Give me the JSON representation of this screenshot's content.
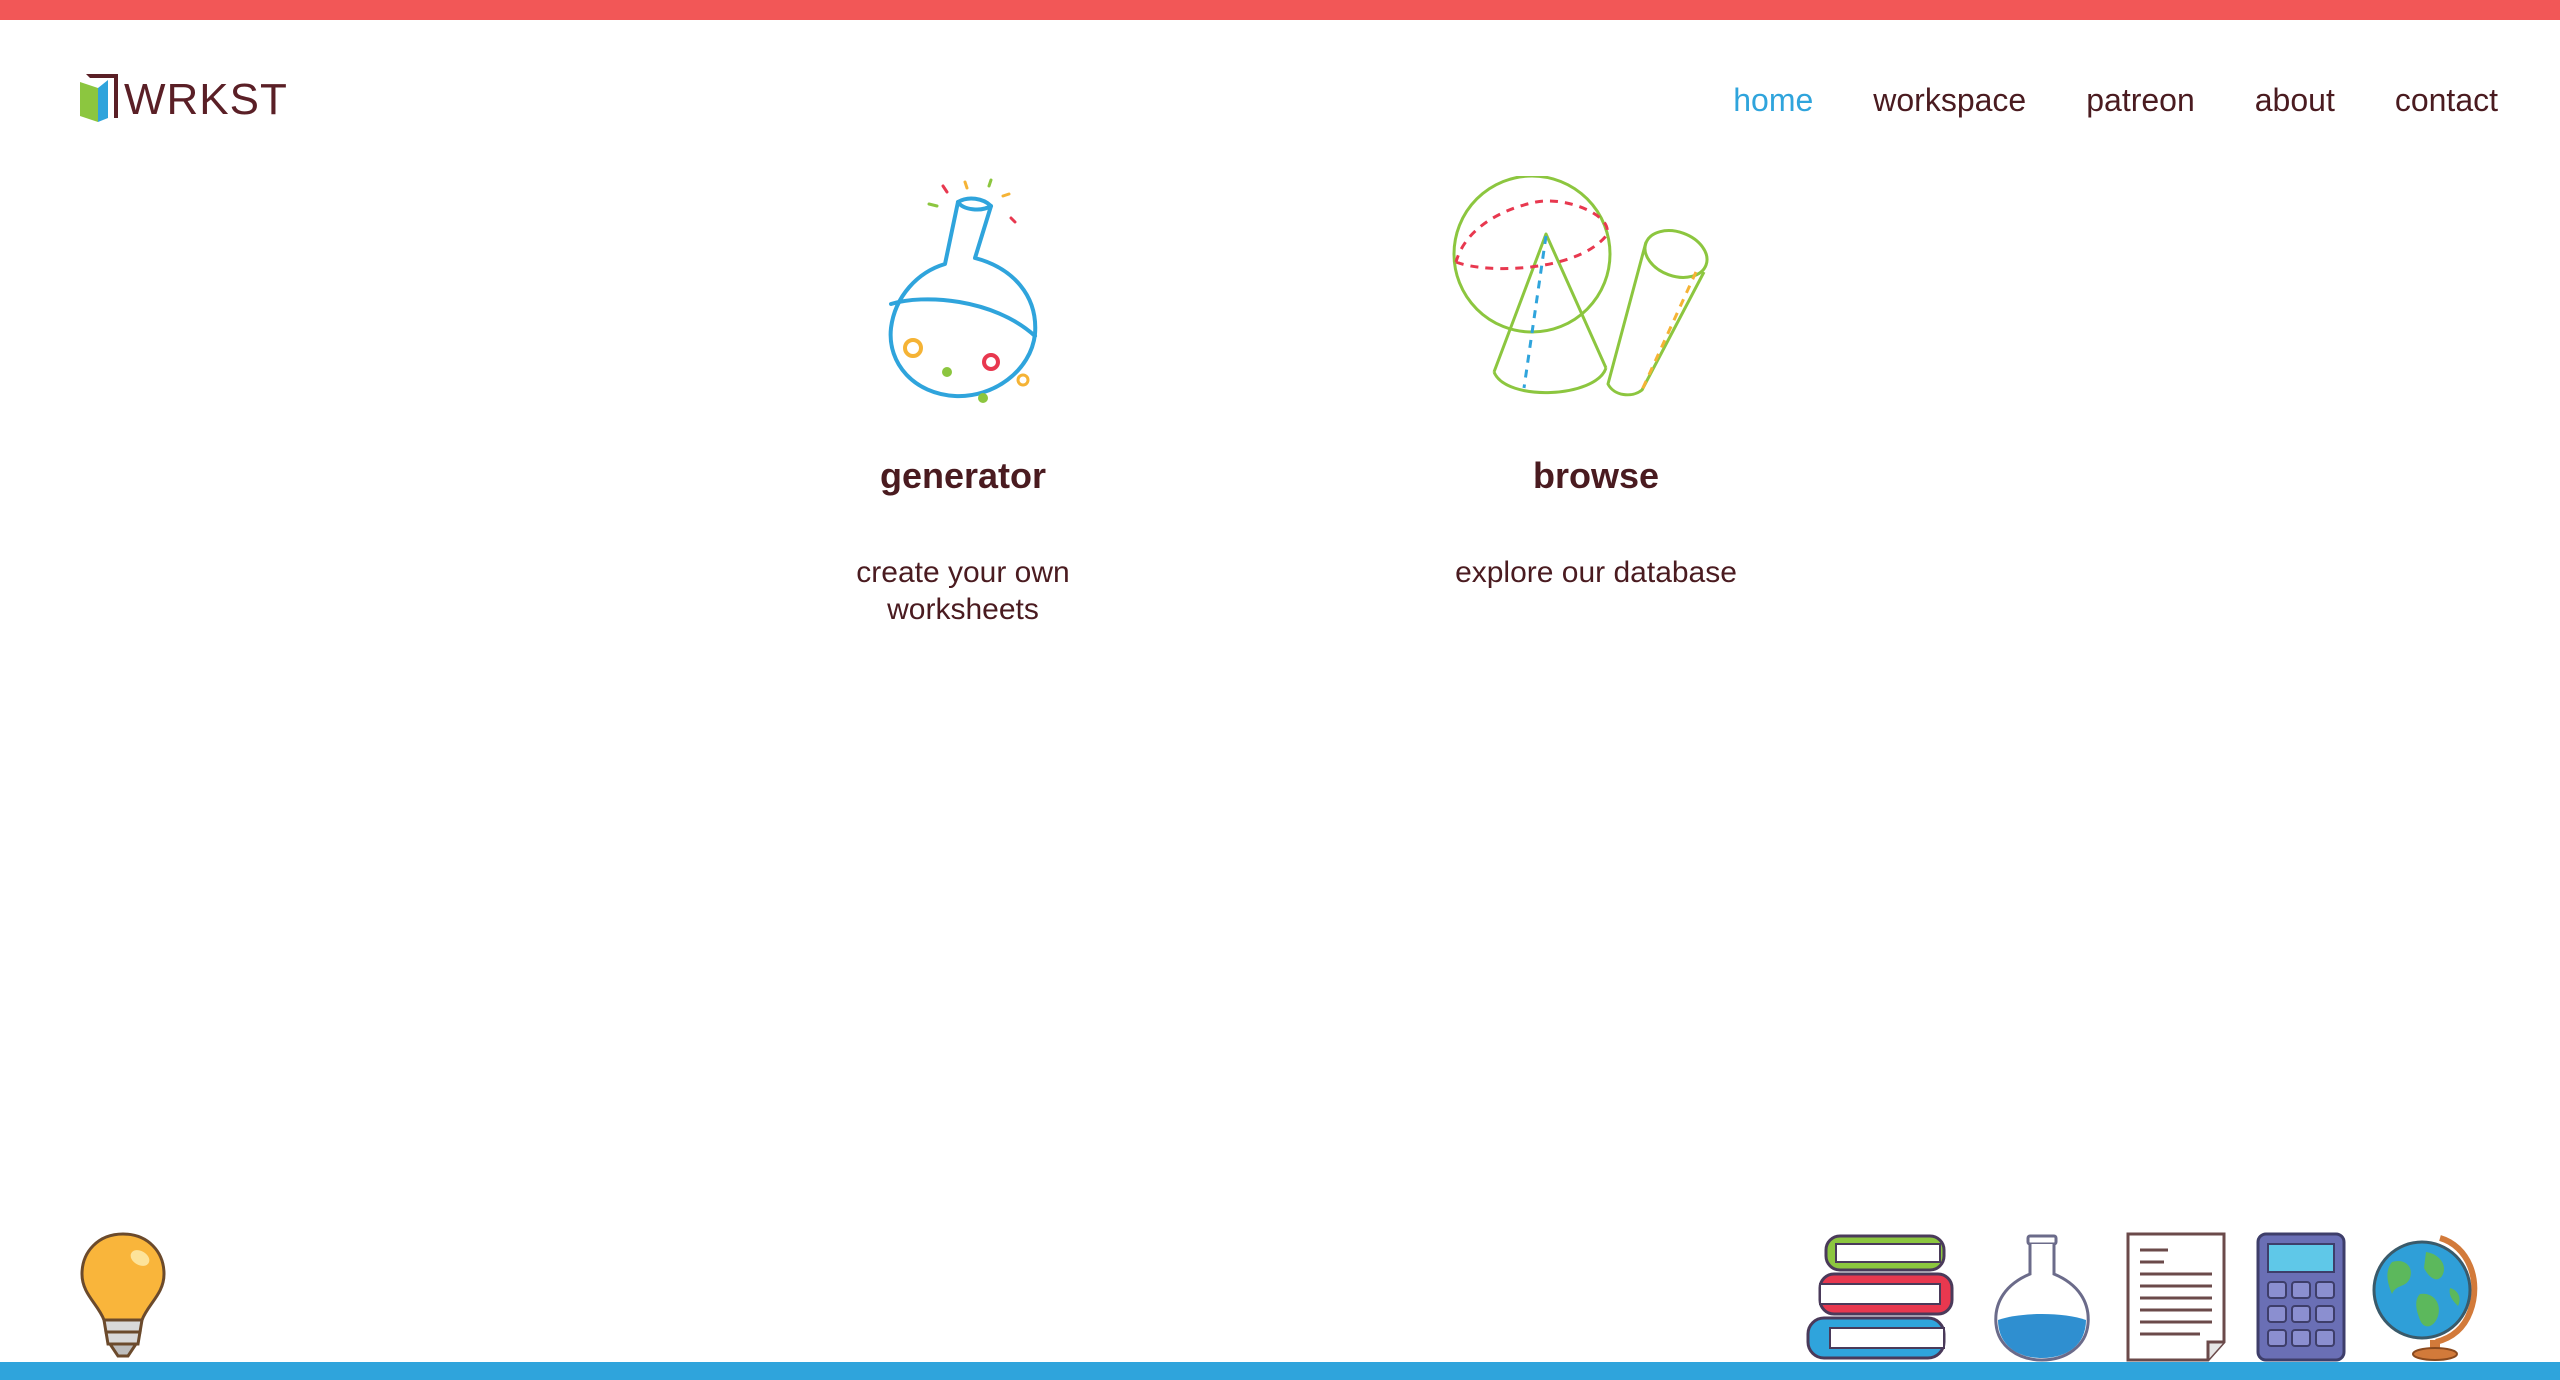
{
  "app": {
    "logo_text": "WRKST",
    "top_bar_color": "#f25757",
    "bottom_bar_color": "#2fa4dc",
    "accent_color": "#2fa4dc"
  },
  "nav": {
    "items": [
      {
        "label": "home",
        "active": true
      },
      {
        "label": "workspace",
        "active": false
      },
      {
        "label": "patreon",
        "active": false
      },
      {
        "label": "about",
        "active": false
      },
      {
        "label": "contact",
        "active": false
      }
    ]
  },
  "cards": [
    {
      "title": "generator",
      "description": "create your own worksheets",
      "icon": "flask-icon"
    },
    {
      "title": "browse",
      "description": "explore our database",
      "icon": "geometry-shapes-icon"
    }
  ],
  "decorations": [
    "lightbulb-icon",
    "books-stack-icon",
    "flask-icon",
    "document-icon",
    "calculator-icon",
    "globe-icon"
  ]
}
